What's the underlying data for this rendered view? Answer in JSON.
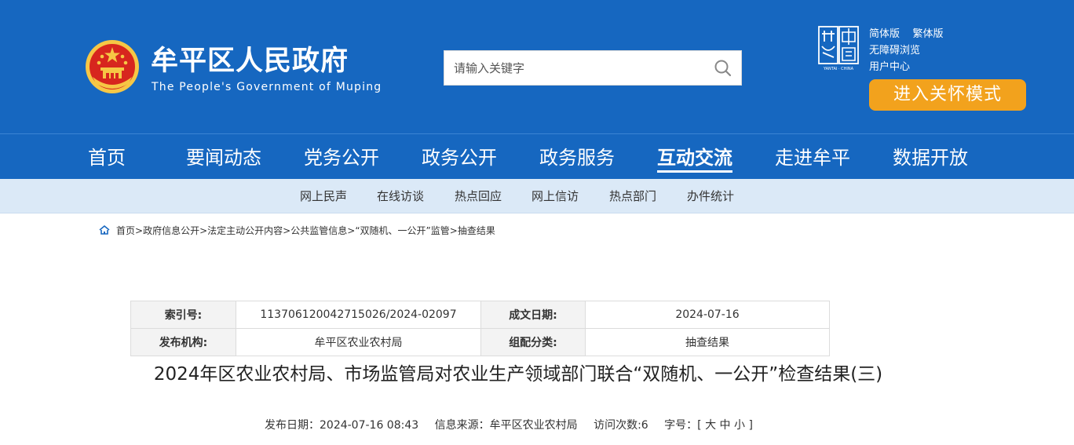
{
  "header": {
    "site_title": "牟平区人民政府",
    "site_subtitle": "The People's Government of Muping",
    "search_placeholder": "请输入关键字",
    "links": {
      "simplified": "简体版",
      "traditional": "繁体版",
      "accessible": "无障碍浏览",
      "user_center": "用户中心"
    },
    "care_mode": "进入关怀模式",
    "yantai_caption": "YANTAI · CHINA"
  },
  "nav": {
    "items": [
      "首页",
      "要闻动态",
      "党务公开",
      "政务公开",
      "政务服务",
      "互动交流",
      "走进牟平",
      "数据开放"
    ],
    "active": "互动交流"
  },
  "subnav": {
    "items": [
      "网上民声",
      "在线访谈",
      "热点回应",
      "网上信访",
      "热点部门",
      "办件统计"
    ]
  },
  "breadcrumb": [
    "首页",
    "政府信息公开",
    "法定主动公开内容",
    "公共监管信息",
    "“双随机、一公开”监管",
    "抽查结果"
  ],
  "info": {
    "index_label": "索引号:",
    "index_value": "113706120042715026/2024-02097",
    "date_label": "成文日期:",
    "date_value": "2024-07-16",
    "org_label": "发布机构:",
    "org_value": "牟平区农业农村局",
    "category_label": "组配分类:",
    "category_value": "抽查结果"
  },
  "article": {
    "title": "2024年区农业农村局、市场监管局对农业生产领域部门联合“双随机、一公开”检查结果(三)",
    "publish": "发布日期：2024-07-16 08:43",
    "source": "信息来源：牟平区农业农村局",
    "visits": "访问次数:6",
    "font_label": "字号：[",
    "font_large": "大",
    "font_medium": "中",
    "font_small": "小",
    "font_end": "]"
  },
  "colors": {
    "primary": "#1667c0",
    "care": "#f2a21d",
    "subnav_bg": "#dbe9f7",
    "emblem_red": "#d7261e",
    "emblem_gold": "#f6c745"
  },
  "icons": [
    "national-emblem-icon",
    "search-icon",
    "yantai-china-logo",
    "home-icon"
  ]
}
